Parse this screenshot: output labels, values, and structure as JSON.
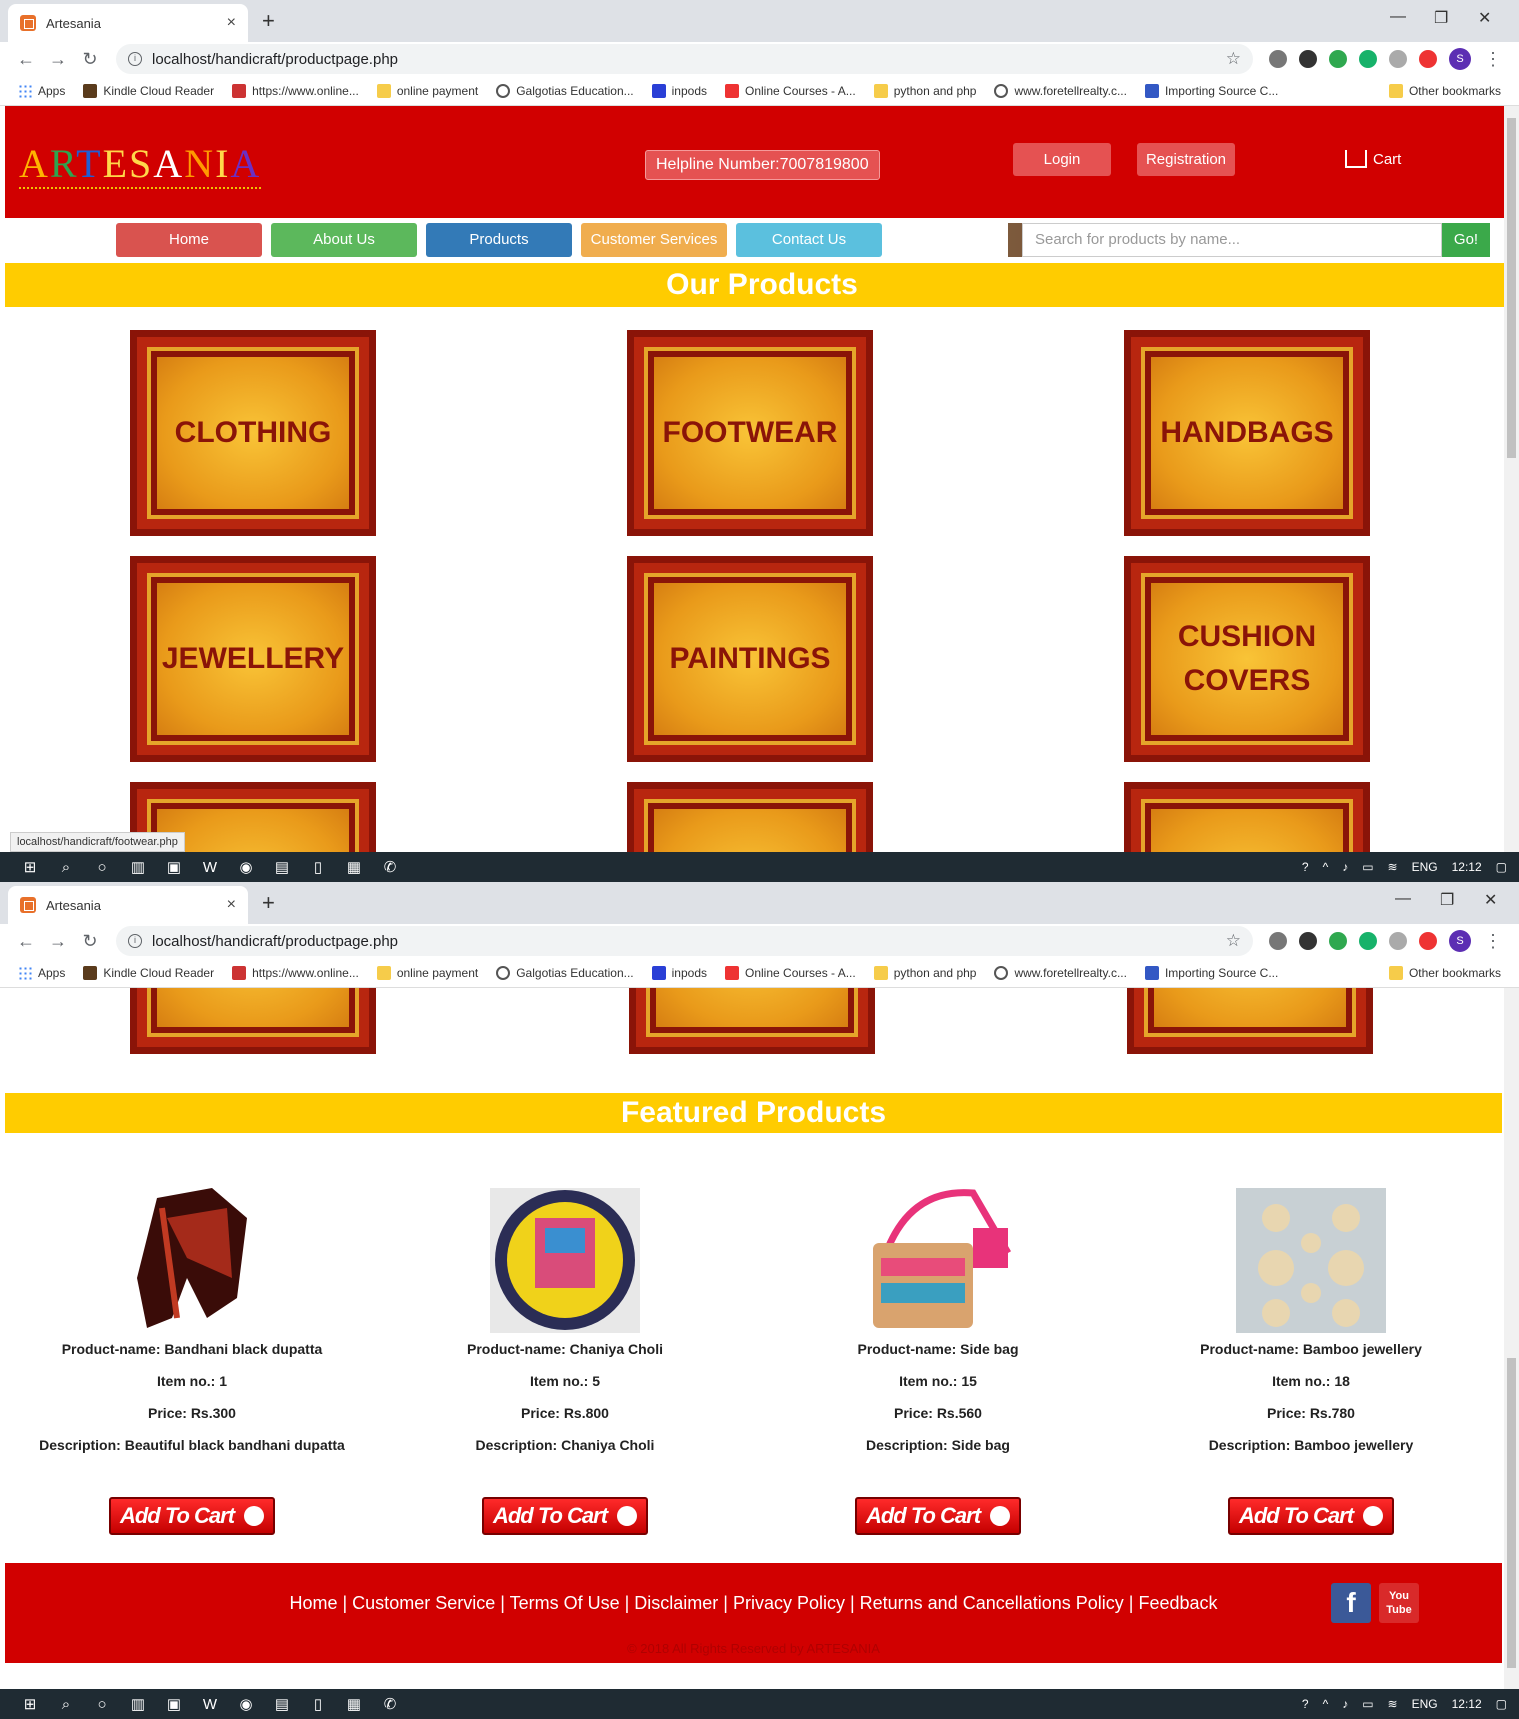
{
  "browser": {
    "tab_title": "Artesania",
    "tab_close": "×",
    "new_tab": "+",
    "url": "localhost/handicraft/productpage.php",
    "avatar_letter": "S",
    "bookmarks": [
      "Apps",
      "Kindle Cloud Reader",
      "https://www.online...",
      "online payment",
      "Galgotias Education...",
      "inpods",
      "Online Courses - A...",
      "python and php",
      "www.foretellrealty.c...",
      "Importing Source C..."
    ],
    "other_bookmarks": "Other bookmarks",
    "status_url": "localhost/handicraft/footwear.php"
  },
  "site": {
    "logo_letters": [
      "A",
      "R",
      "T",
      "E",
      "S",
      "A",
      "N",
      "I",
      "A"
    ],
    "logo_colors": [
      "#ffb400",
      "#2ea44f",
      "#1f5ed6",
      "#ffd84a",
      "#ffd84a",
      "#ffffff",
      "#ff9a00",
      "#ffd84a",
      "#6b2fc4"
    ],
    "helpline": "Helpline Number:7007819800",
    "login": "Login",
    "registration": "Registration",
    "cart": "Cart",
    "nav": [
      {
        "label": "Home",
        "color": "#d9534f"
      },
      {
        "label": "About Us",
        "color": "#5cb85c"
      },
      {
        "label": "Products",
        "color": "#337ab7"
      },
      {
        "label": "Customer Services",
        "color": "#f0ad4e"
      },
      {
        "label": "Contact Us",
        "color": "#5bc0de"
      }
    ],
    "search_placeholder": "Search for products by name...",
    "search_go": "Go!",
    "our_products_title": "Our Products",
    "categories": [
      "CLOTHING",
      "FOOTWEAR",
      "HANDBAGS",
      "JEWELLERY",
      "PAINTINGS",
      "CUSHION COVERS"
    ],
    "featured_title": "Featured Products",
    "products": [
      {
        "name": "Product-name: Bandhani black dupatta",
        "item": "Item no.: 1",
        "price": "Price: Rs.300",
        "desc": "Description: Beautiful black bandhani dupatta"
      },
      {
        "name": "Product-name: Chaniya Choli",
        "item": "Item no.: 5",
        "price": "Price: Rs.800",
        "desc": "Description: Chaniya Choli"
      },
      {
        "name": "Product-name: Side bag",
        "item": "Item no.: 15",
        "price": "Price: Rs.560",
        "desc": "Description: Side bag"
      },
      {
        "name": "Product-name: Bamboo jewellery",
        "item": "Item no.: 18",
        "price": "Price: Rs.780",
        "desc": "Description: Bamboo jewellery"
      }
    ],
    "add_to_cart": "Add To Cart",
    "footer_links": "Home | Customer Service | Terms Of Use | Disclaimer | Privacy Policy | Returns and Cancellations Policy | Feedback",
    "copyright": "© 2018 All Rights Reserved by ARTESANIA",
    "facebook": "f",
    "youtube": "You Tube"
  },
  "taskbar": {
    "lang": "ENG",
    "time": "12:12"
  },
  "colors": {
    "brand_red": "#d10000",
    "section_yellow": "#ffcc00"
  }
}
